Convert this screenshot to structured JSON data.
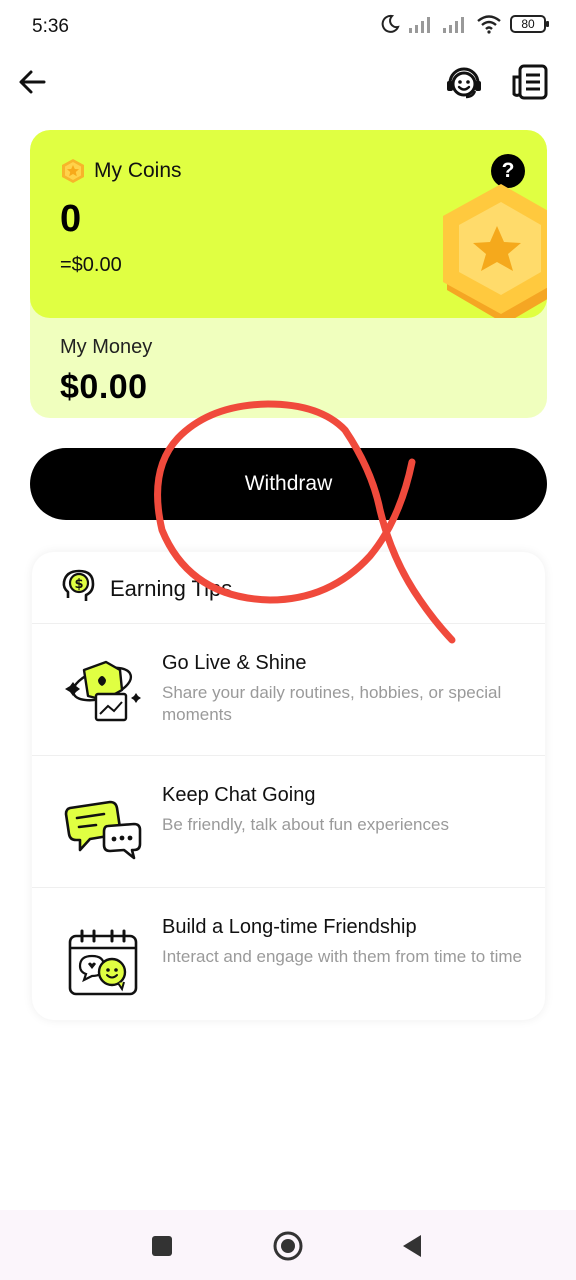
{
  "status_bar": {
    "time": "5:36",
    "battery": "80"
  },
  "wallet": {
    "coins_label": "My Coins",
    "coins_amount": "0",
    "coins_usd": "=$0.00",
    "help_label": "?",
    "money_label": "My Money",
    "money_amount": "$0.00"
  },
  "actions": {
    "withdraw_label": "Withdraw"
  },
  "tips": {
    "title": "Earning Tips",
    "items": [
      {
        "title": "Go Live & Shine",
        "desc": "Share your daily routines, hobbies, or special moments",
        "icon": "live-photo-icon"
      },
      {
        "title": "Keep Chat Going",
        "desc": "Be friendly, talk about fun experiences",
        "icon": "chat-bubbles-icon"
      },
      {
        "title": "Build a Long-time Friendship",
        "desc": "Interact and engage with them from time to time",
        "icon": "calendar-friend-icon"
      }
    ]
  },
  "colors": {
    "accent": "#e0ff42",
    "accent_light": "#f0ffbe",
    "annotation": "#f04a3c"
  }
}
